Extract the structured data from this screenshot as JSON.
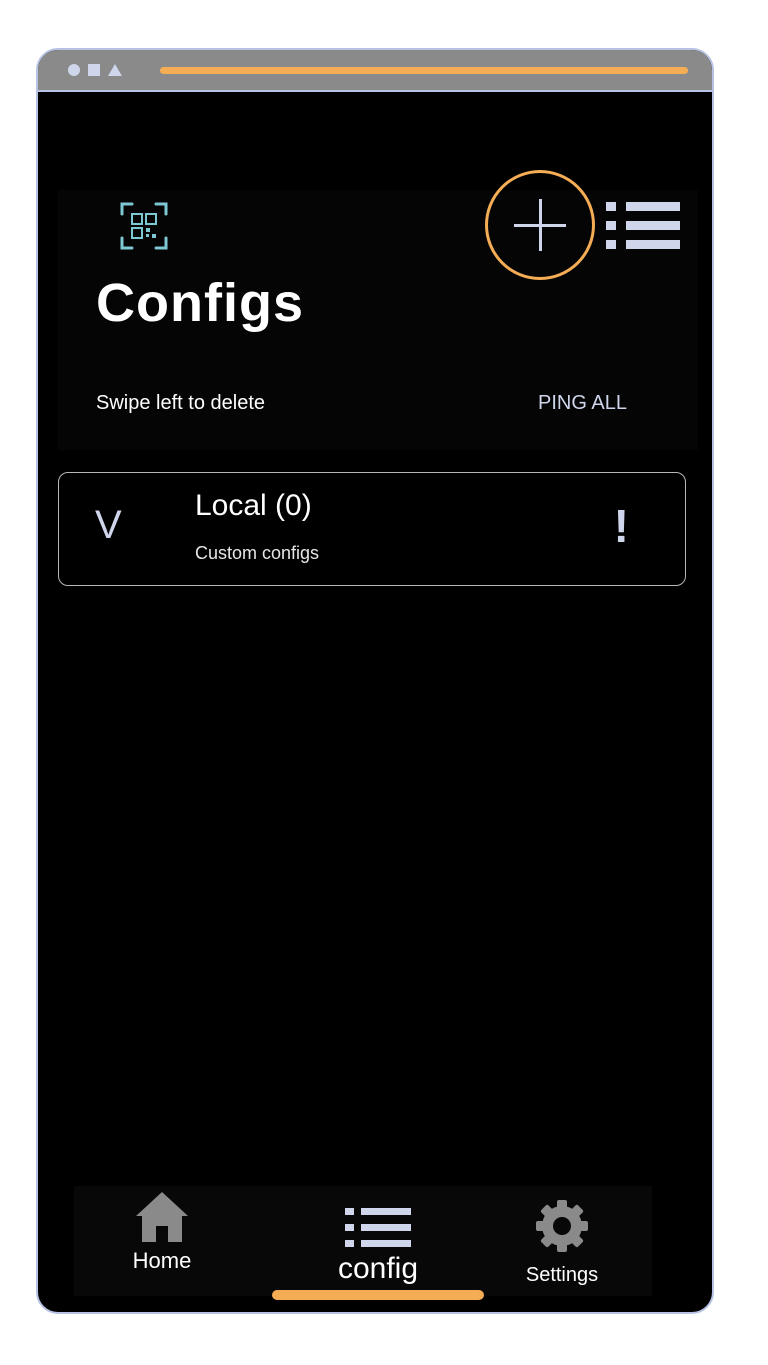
{
  "app": {
    "title": "Configs"
  },
  "header": {
    "swipe_hint": "Swipe left to delete",
    "ping_all_label": "PING ALL",
    "qr_icon": "qr-code-icon",
    "add_icon": "plus-icon",
    "list_icon": "list-icon"
  },
  "configs": [
    {
      "title": "Local (0)",
      "subtitle": "Custom configs",
      "expand_glyph": "V",
      "alert_glyph": "!"
    }
  ],
  "bottom_nav": {
    "items": [
      {
        "label": "Home",
        "icon": "home-icon"
      },
      {
        "label": "config",
        "icon": "list-icon",
        "active": true
      },
      {
        "label": "Settings",
        "icon": "gear-icon"
      }
    ]
  },
  "colors": {
    "accent": "#f5ad55",
    "icon": "#cfd6ec",
    "qr": "#7ec8d3",
    "background": "#000000"
  }
}
